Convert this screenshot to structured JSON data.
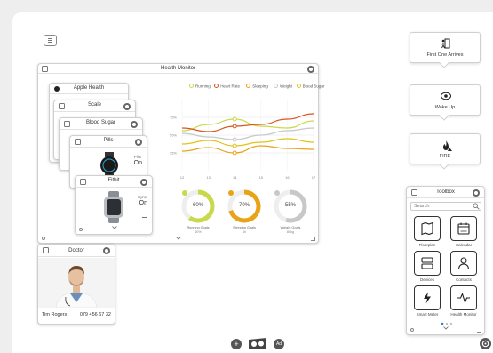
{
  "health_monitor": {
    "title": "Health Monitor",
    "legend": [
      {
        "label": "Running",
        "color": "#c9d94a"
      },
      {
        "label": "Heart Rate",
        "color": "#d9541e"
      },
      {
        "label": "Sleeping",
        "color": "#e8a317"
      },
      {
        "label": "Weight",
        "color": "#c8c8c8"
      },
      {
        "label": "Blood Sugar",
        "color": "#e3c21a"
      }
    ],
    "y_ticks": [
      "75%",
      "50%",
      "25%"
    ],
    "x_ticks": [
      "12",
      "13",
      "14",
      "15",
      "16",
      "17"
    ],
    "donuts": [
      {
        "value": "60%",
        "label": "Running Goals",
        "sub": "60%",
        "color": "#c9d94a"
      },
      {
        "value": "70%",
        "label": "Sleeping Goals",
        "sub": "4h",
        "color": "#e8a317"
      },
      {
        "value": "55%",
        "label": "Weight Goals",
        "sub": "80kg",
        "color": "#c8c8c8"
      }
    ]
  },
  "stack": {
    "apple_health": "Apple Health",
    "scale": "Scale",
    "blood_sugar": "Blood Sugar",
    "pills": "Pills",
    "pills_state_label": "Pills",
    "pills_state": "On",
    "fitbit": "Fitbit",
    "fitbit_state_label": "Sync",
    "fitbit_state": "On"
  },
  "doctor": {
    "title": "Doctor",
    "name": "Tim Rogers",
    "phone": "079 456 67 32"
  },
  "callouts": [
    {
      "label": "First One Arrives",
      "icon": "door-icon"
    },
    {
      "label": "Wake Up",
      "icon": "eye-icon"
    },
    {
      "label": "FIRE",
      "icon": "fire-icon"
    }
  ],
  "toolbox": {
    "title": "Toolbox",
    "search_placeholder": "Search",
    "items": [
      {
        "label": "Floorplan",
        "icon": "floorplan-icon"
      },
      {
        "label": "Calendar",
        "icon": "calendar-icon"
      },
      {
        "label": "Devices",
        "icon": "devices-icon"
      },
      {
        "label": "Contacts",
        "icon": "contacts-icon"
      },
      {
        "label": "Smart Meter",
        "icon": "lightning-icon"
      },
      {
        "label": "Health Monitor",
        "icon": "pulse-icon"
      }
    ]
  },
  "bottom_bar": {
    "add_label": "+",
    "ad_label": "Ad"
  },
  "chart_data": {
    "type": "line",
    "x": [
      12,
      13,
      14,
      15,
      16,
      17
    ],
    "y_ticks": [
      "75%",
      "50%",
      "25%"
    ],
    "series": [
      {
        "name": "Running",
        "values": [
          55,
          62,
          68,
          60,
          58,
          66
        ]
      },
      {
        "name": "Heart Rate",
        "values": [
          58,
          54,
          60,
          62,
          68,
          74
        ]
      },
      {
        "name": "Sleeping",
        "values": [
          32,
          36,
          30,
          38,
          35,
          34
        ]
      },
      {
        "name": "Weight",
        "values": [
          52,
          48,
          45,
          50,
          55,
          58
        ]
      },
      {
        "name": "Blood Sugar",
        "values": [
          40,
          44,
          38,
          42,
          46,
          42
        ]
      }
    ]
  }
}
